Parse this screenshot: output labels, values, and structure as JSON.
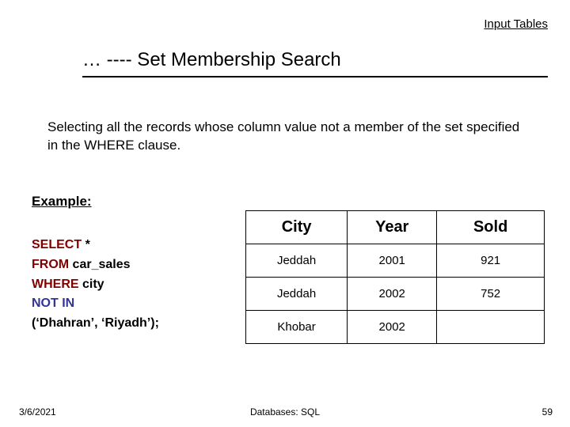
{
  "link": {
    "input_tables": "Input Tables"
  },
  "title": "… ---- Set Membership Search",
  "body": "Selecting all the records whose column value not a member of the set specified in the WHERE clause.",
  "example_label": "Example:",
  "sql": {
    "select": "SELECT",
    "star": " *",
    "from": "FROM",
    "from_tbl": " car_sales",
    "where": "WHERE",
    "where_col": " city",
    "notin": "NOT IN",
    "list": "(‘Dhahran’, ‘Riyadh’);"
  },
  "chart_data": {
    "type": "table",
    "title": "",
    "columns": [
      "City",
      "Year",
      "Sold"
    ],
    "rows": [
      {
        "City": "Jeddah",
        "Year": "2001",
        "Sold": "921"
      },
      {
        "City": "Jeddah",
        "Year": "2002",
        "Sold": "752"
      },
      {
        "City": "Khobar",
        "Year": "2002",
        "Sold": ""
      }
    ]
  },
  "footer": {
    "date": "3/6/2021",
    "center": "Databases: SQL",
    "page": "59"
  }
}
